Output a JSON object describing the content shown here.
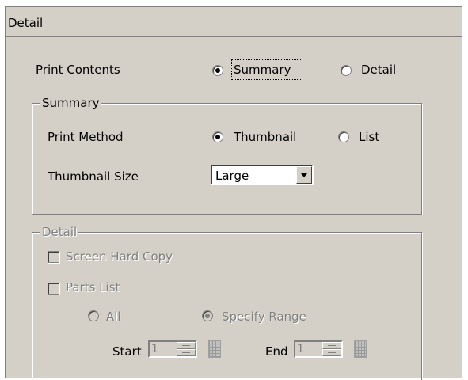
{
  "title": "Detail",
  "print_contents": {
    "label": "Print Contents",
    "options": [
      "Summary",
      "Detail"
    ],
    "selected": "Summary"
  },
  "summary_group": {
    "legend": "Summary",
    "print_method": {
      "label": "Print Method",
      "options": [
        "Thumbnail",
        "List"
      ],
      "selected": "Thumbnail"
    },
    "thumbnail_size": {
      "label": "Thumbnail Size",
      "value": "Large"
    }
  },
  "detail_group": {
    "legend": "Detail",
    "screen_hard_copy": "Screen Hard Copy",
    "parts_list": "Parts List",
    "range_options": [
      "All",
      "Specify Range"
    ],
    "range_selected": "Specify Range",
    "start_label": "Start",
    "start_value": "1",
    "end_label": "End",
    "end_value": "1"
  }
}
